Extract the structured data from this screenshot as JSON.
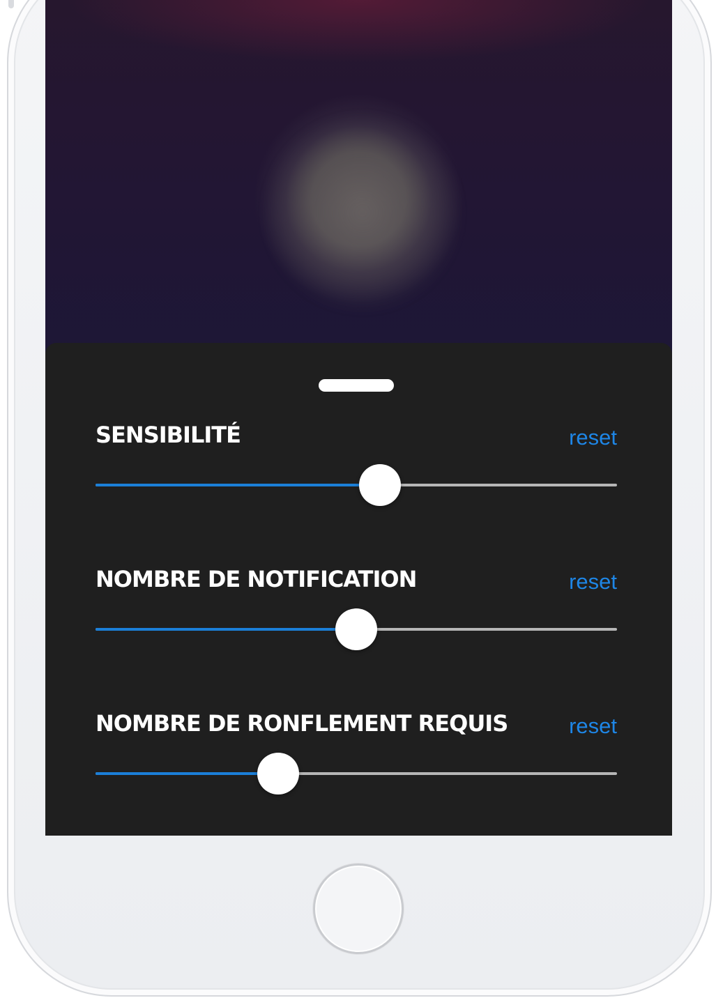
{
  "settings": [
    {
      "title": "SENSIBILITÉ",
      "reset_label": "reset",
      "value": 0.545
    },
    {
      "title": "NOMBRE DE NOTIFICATION",
      "reset_label": "reset",
      "value": 0.5
    },
    {
      "title": "NOMBRE DE RONFLEMENT REQUIS",
      "reset_label": "reset",
      "value": 0.35
    }
  ],
  "colors": {
    "accent": "#1b7fd8",
    "link": "#1e86e6",
    "sheet_background": "#1f1f1f",
    "track": "#b6b6b6",
    "thumb": "#ffffff"
  },
  "icons": {
    "grabber": "sheet-grabber-icon",
    "home": "home-button-icon"
  }
}
